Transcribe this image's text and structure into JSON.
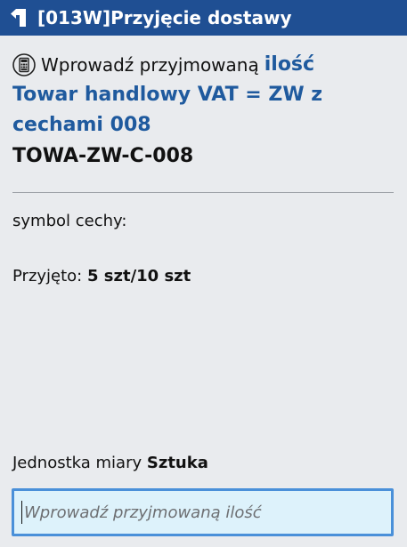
{
  "header": {
    "title": "[013W]Przyjęcie dostawy",
    "back_icon": "back-arrow-icon"
  },
  "prompt": {
    "icon": "calculator-icon",
    "text": "Wprowadź przyjmowaną",
    "highlight": "ilość"
  },
  "item": {
    "name": "Towar handlowy VAT = ZW z cechami 008",
    "code": "TOWA-ZW-C-008"
  },
  "feature": {
    "label": "symbol cechy:"
  },
  "received": {
    "label": "Przyjęto:",
    "value": "5 szt/10 szt"
  },
  "unit": {
    "label": "Jednostka miary",
    "value": "Sztuka"
  },
  "quantity_input": {
    "value": "",
    "placeholder": "Wprowadź przyjmowaną ilość"
  },
  "colors": {
    "header_bg": "#1f4f93",
    "accent_text": "#1f5a9e",
    "input_bg": "#ddf2fb",
    "input_border": "#4a90d9",
    "page_bg": "#e9ebee"
  }
}
